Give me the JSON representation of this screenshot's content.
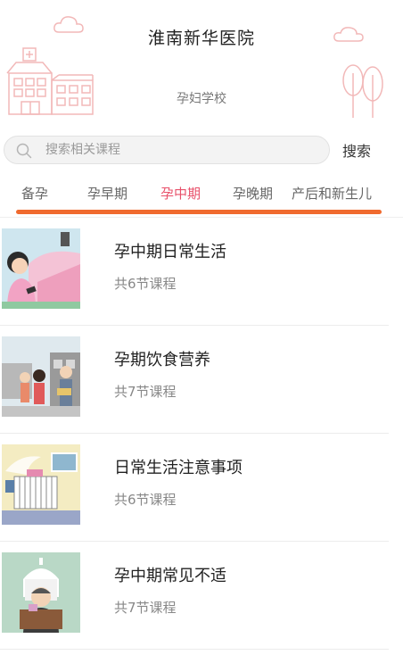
{
  "header": {
    "title": "淮南新华医院",
    "subtitle": "孕妇学校"
  },
  "search": {
    "placeholder": "搜索相关课程",
    "value": "",
    "button_label": "搜索"
  },
  "tabs": [
    {
      "label": "备孕",
      "active": false
    },
    {
      "label": "孕早期",
      "active": false
    },
    {
      "label": "孕中期",
      "active": true
    },
    {
      "label": "孕晚期",
      "active": false
    },
    {
      "label": "产后和新生儿",
      "active": false
    }
  ],
  "courses": [
    {
      "title": "孕中期日常生活",
      "count": "共6节课程",
      "icon": "pregnant-woman-with-phone-illustration"
    },
    {
      "title": "孕期饮食营养",
      "count": "共7节课程",
      "icon": "family-shopping-illustration"
    },
    {
      "title": "日常生活注意事项",
      "count": "共6节课程",
      "icon": "radiator-room-illustration"
    },
    {
      "title": "孕中期常见不适",
      "count": "共7节课程",
      "icon": "doctor-at-podium-illustration"
    }
  ],
  "colors": {
    "accent": "#e8506a",
    "indicator": "#f06a2e",
    "deco_line": "#f2b8b8"
  }
}
